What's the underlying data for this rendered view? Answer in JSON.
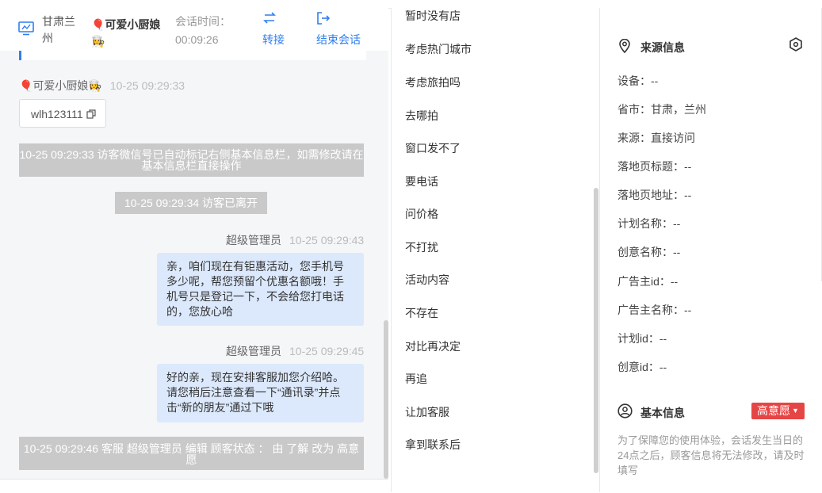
{
  "header": {
    "visitor_location": "甘肃兰州",
    "agent_name": "🎈可爱小厨娘👩‍🍳",
    "session_label": "会话时间：",
    "session_time": "00:09:26",
    "transfer_label": "转接",
    "end_label": "结束会话"
  },
  "messages": {
    "m1_sender": "🎈可爱小厨娘👩‍🍳",
    "m1_time": "10-25 09:29:33",
    "m1_text": "wlh123111",
    "sys1": "10-25 09:29:33 访客微信号已自动标记右侧基本信息栏，如需修改请在基本信息栏直接操作",
    "sys2": "10-25 09:29:34 访客已离开",
    "m2_sender": "超级管理员",
    "m2_time": "10-25 09:29:43",
    "m2_text": "亲，咱们现在有钜惠活动，您手机号多少呢，帮您预留个优惠名额哦！手机号只是登记一下，不会给您打电话的，您放心哈",
    "m3_sender": "超级管理员",
    "m3_time": "10-25 09:29:45",
    "m3_text": "好的亲，现在安排客服加您介绍哈。请您稍后注意查看一下“通讯录”并点击“新的朋友”通过下哦",
    "sys3": "10-25 09:29:46 客服 超级管理员 编辑 顾客状态 ： 由 了解 改为 高意愿"
  },
  "quick_replies": [
    "暂时没有店",
    "考虑热门城市",
    "考虑旅拍吗",
    "去哪拍",
    "窗口发不了",
    "要电话",
    "问价格",
    "不打扰",
    "活动内容",
    "不存在",
    "对比再决定",
    "再追",
    "让加客服",
    "拿到联系后"
  ],
  "source": {
    "title": "来源信息",
    "rows": [
      "设备：--",
      "省市：甘肃，兰州",
      "来源：直接访问",
      "落地页标题：--",
      "落地页地址：--",
      "计划名称：--",
      "创意名称：--",
      "广告主id：--",
      "广告主名称：--",
      "计划id：--",
      "创意id：--"
    ]
  },
  "basic": {
    "title": "基本信息",
    "intent_badge": "高意愿",
    "notice": "为了保障您的使用体验，会话发生当日的24点之后，顾客信息将无法修改，请及时填写"
  },
  "colors": {
    "accent": "#2f7ef0",
    "badge": "#e64545",
    "agent_bubble": "#dce9fc",
    "system_bar": "#c9c9c9"
  },
  "icons": [
    "monitor-icon",
    "swap-icon",
    "exit-icon",
    "location-pin-icon",
    "settings-hex-icon",
    "user-circle-icon",
    "copy-icon",
    "caret-down-icon"
  ]
}
